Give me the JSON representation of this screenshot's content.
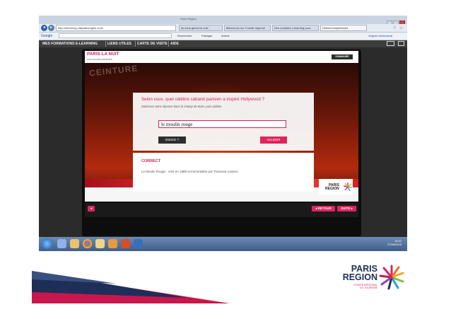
{
  "browser": {
    "window_title": "Paris Région",
    "url": "http://elearning.visitparisregion.com/",
    "tabs": [
      {
        "label": "Ils vous gérent la voie",
        "active": false
      },
      {
        "label": "Bienvenue sur Comité régional",
        "active": false
      },
      {
        "label": "Des modules e-learning pour",
        "active": false
      },
      {
        "label": "OnlineCompétences",
        "active": true
      }
    ],
    "search_engine": "Google",
    "google_buttons": [
      "Rechercher",
      "Partager",
      "Autres"
    ],
    "user": "Virginie Delacheval"
  },
  "site_nav": {
    "items": [
      "MES FORMATIONS E-LEARNING",
      "LIENS UTILES",
      "CARTE DE VISITE",
      "AIDE"
    ]
  },
  "course": {
    "title": "PARIS LA NUIT",
    "subtitle": "Les incontournables",
    "menu_button": "SOMMAIRE",
    "background_sign": "CEINTURE",
    "question": "Selon vous, quel célèbre cabaret parisien a inspiré Hollywood ?",
    "instruction": "Saisissez votre réponse dans le champ de texte, puis validez.",
    "answer_value": "le moulin rouge",
    "hint_button": "INDICE ?",
    "validate_button": "VALIDER",
    "feedback_title": "CORRECT",
    "feedback_text": "Le Moulin Rouge : créé en 1889 et immortalisé par Toulouse-Lautrec.",
    "logo_line1": "PARIS",
    "logo_line2": "REGION",
    "back_button": "◂ RETOUR",
    "next_button": "SUITE ▸",
    "sound_icon": "speaker-icon"
  },
  "taskbar": {
    "time": "18:41",
    "date": "27/06/2016",
    "app_icons": [
      "ie-icon",
      "folder-icon",
      "chrome-icon",
      "explorer-icon",
      "outlook-icon",
      "powerpoint-icon",
      "media-icon"
    ]
  },
  "slide_footer": {
    "brand_line1": "PARIS",
    "brand_line2": "REGION",
    "brand_tag1": "COMITÉ RÉGIONAL",
    "brand_tag2": "DU TOURISME"
  },
  "colors": {
    "accent": "#e0245c",
    "brand_navy": "#1d2f57",
    "site_bar": "#3d3d3d"
  }
}
